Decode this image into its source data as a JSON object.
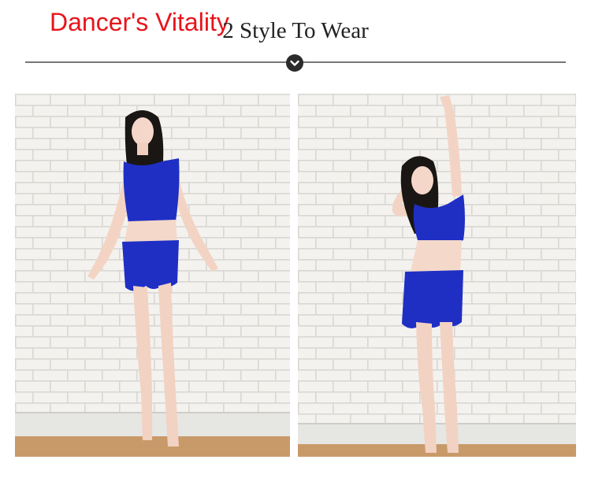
{
  "header": {
    "brand": "Dancer's Vitality",
    "title": "2 Style To Wear"
  },
  "icons": {
    "section_toggle": "chevron-down-icon"
  },
  "colors": {
    "brand_red": "#e8141b",
    "outfit_blue": "#1f2fc4",
    "wall": "#f2f1ee",
    "floor": "#c99a69"
  }
}
